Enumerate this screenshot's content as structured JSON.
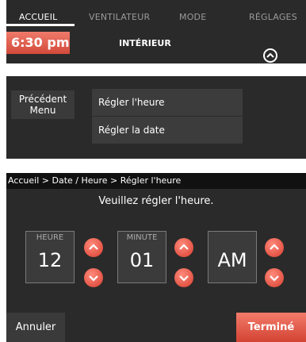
{
  "tabs": {
    "home": "ACCUEIL",
    "fan": "VENTILATEUR",
    "mode": "MODE",
    "settings": "RÉGLAGES"
  },
  "panel1": {
    "time": "6:30 pm",
    "location": "INTÉRIEUR"
  },
  "panel2": {
    "previous_menu": "Précédent Menu",
    "items": [
      "Régler l'heure",
      "Régler la date"
    ]
  },
  "panel3": {
    "breadcrumb": "Accueil > Date / Heure > Régler l'heure",
    "prompt": "Veuillez régler l'heure.",
    "hour_label": "HEURE",
    "hour_value": "12",
    "minute_label": "MINUTE",
    "minute_value": "01",
    "ampm_value": "AM",
    "cancel": "Annuler",
    "done": "Terminé"
  },
  "colors": {
    "accent_red": "#d84a3a",
    "panel_bg": "#2a2a2a",
    "breadcrumb_bg": "#111111"
  },
  "icons": {
    "collapse": "chevron-up-icon",
    "increment": "chevron-up-icon",
    "decrement": "chevron-down-icon"
  }
}
